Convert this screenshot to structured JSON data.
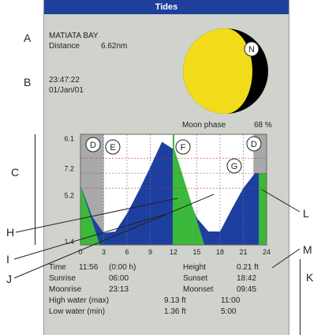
{
  "window": {
    "title": "Tides"
  },
  "location": {
    "name": "MATIATA BAY",
    "distance_label": "Distance",
    "distance_value": "6.62nm"
  },
  "datetime": {
    "time": "23:47:22",
    "date": "01/Jan/01"
  },
  "moon": {
    "phase_label": "Moon phase",
    "phase_value": "68 %",
    "lit_color": "#f2dc1a",
    "dark_color": "#000000"
  },
  "colors": {
    "tide_fill": "#1d3fa0",
    "gradient_fill": "#3cb83a",
    "night_shade": "#9a9a9a",
    "plot_bg": "#ffffff",
    "title_bar": "#1f3f9c",
    "screen_bg": "#cfd3cc"
  },
  "chart_data": {
    "type": "area",
    "x": [
      0,
      1.5,
      3,
      4.5,
      6,
      7.5,
      9,
      10.5,
      12,
      13.5,
      15,
      16.5,
      18,
      19.5,
      21,
      22.5,
      24
    ],
    "y": [
      0.6,
      -0.45,
      -1.0,
      -0.95,
      -0.35,
      0.4,
      1.2,
      2.05,
      1.8,
      0.45,
      -0.5,
      -0.95,
      -0.95,
      -0.2,
      0.5,
      1.0,
      1.0
    ],
    "xlim": [
      0,
      24
    ],
    "ylim": [
      -1.4,
      2.3
    ],
    "x_ticks": [
      "0",
      "3",
      "6",
      "9",
      "12",
      "15",
      "18",
      "21",
      "24"
    ],
    "y_ticks": [
      "6.1",
      "7.2",
      "5.2",
      "1.4"
    ],
    "grid": true
  },
  "readouts": {
    "time_label": "Time",
    "time_value": "11:56",
    "time_offset": "(0:00 h)",
    "height_label": "Height",
    "height_value": "0.21 ft",
    "sunrise_label": "Sunrise",
    "sunrise_value": "06:00",
    "sunset_label": "Sunset",
    "sunset_value": "18:42",
    "moonrise_label": "Moonrise",
    "moonrise_value": "23:13",
    "moonset_label": "Moonset",
    "moonset_value": "09:45",
    "high_label": "High water (max)",
    "high_height": "9.13 ft",
    "high_time": "11:00",
    "low_label": "Low water (min)",
    "low_height": "1.36 ft",
    "low_time": "5:00"
  },
  "callouts": {
    "A": "A",
    "B": "B",
    "C": "C",
    "H": "H",
    "I": "I",
    "J": "J",
    "L": "L",
    "M": "M",
    "K": "K",
    "D": "D",
    "E": "E",
    "F": "F",
    "G": "G",
    "N": "N"
  }
}
